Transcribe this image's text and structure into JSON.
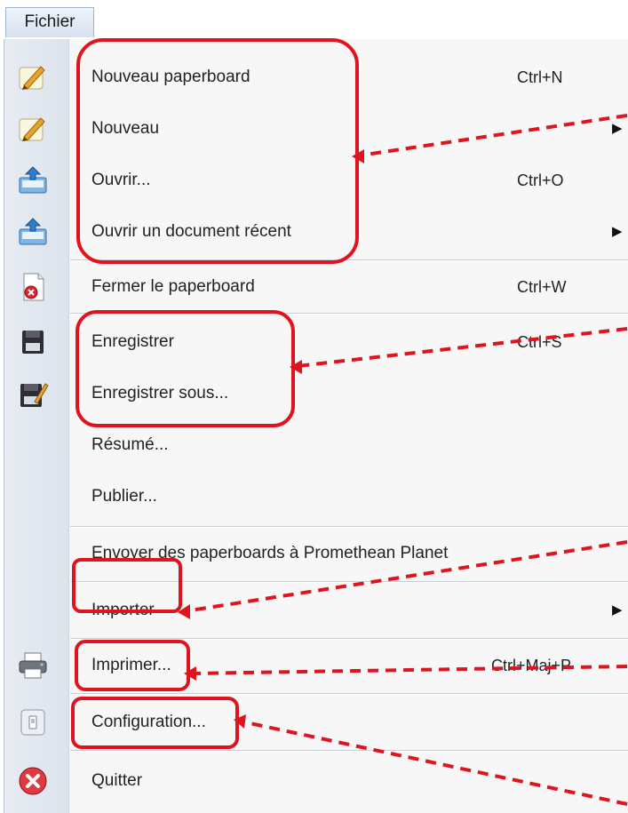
{
  "menubar": {
    "title": "Fichier"
  },
  "menu": {
    "items": [
      {
        "label": "Nouveau paperboard",
        "shortcut": "Ctrl+N",
        "icon": "pen-paper-icon"
      },
      {
        "label": "Nouveau",
        "shortcut": "",
        "icon": "pen-paper-icon",
        "submenu": "▶"
      },
      {
        "label": "Ouvrir...",
        "shortcut": "Ctrl+O",
        "icon": "open-tray-icon"
      },
      {
        "label": "Ouvrir un document récent",
        "shortcut": "",
        "icon": "open-tray-icon",
        "submenu": "▶"
      },
      {
        "label": "Fermer le paperboard",
        "shortcut": "Ctrl+W",
        "icon": "close-document-icon"
      },
      {
        "label": "Enregistrer",
        "shortcut": "Ctrl+S",
        "icon": "save-icon"
      },
      {
        "label": "Enregistrer sous...",
        "shortcut": "",
        "icon": "save-as-icon"
      },
      {
        "label": "Résumé...",
        "shortcut": "",
        "icon": ""
      },
      {
        "label": "Publier...",
        "shortcut": "",
        "icon": ""
      },
      {
        "label": "Envoyer des paperboards à Promethean Planet",
        "shortcut": "",
        "icon": ""
      },
      {
        "label": "Importer",
        "shortcut": "",
        "icon": "",
        "submenu": "▶"
      },
      {
        "label": "Imprimer...",
        "shortcut": "Ctrl+Maj+P",
        "icon": "printer-icon"
      },
      {
        "label": "Configuration...",
        "shortcut": "",
        "icon": "configuration-icon"
      },
      {
        "label": "Quitter",
        "shortcut": "",
        "icon": "quit-icon"
      }
    ]
  },
  "colors": {
    "annotation": "#e0141e",
    "gutter": "#e3e8f0",
    "menu_background": "#f7f7f7"
  }
}
